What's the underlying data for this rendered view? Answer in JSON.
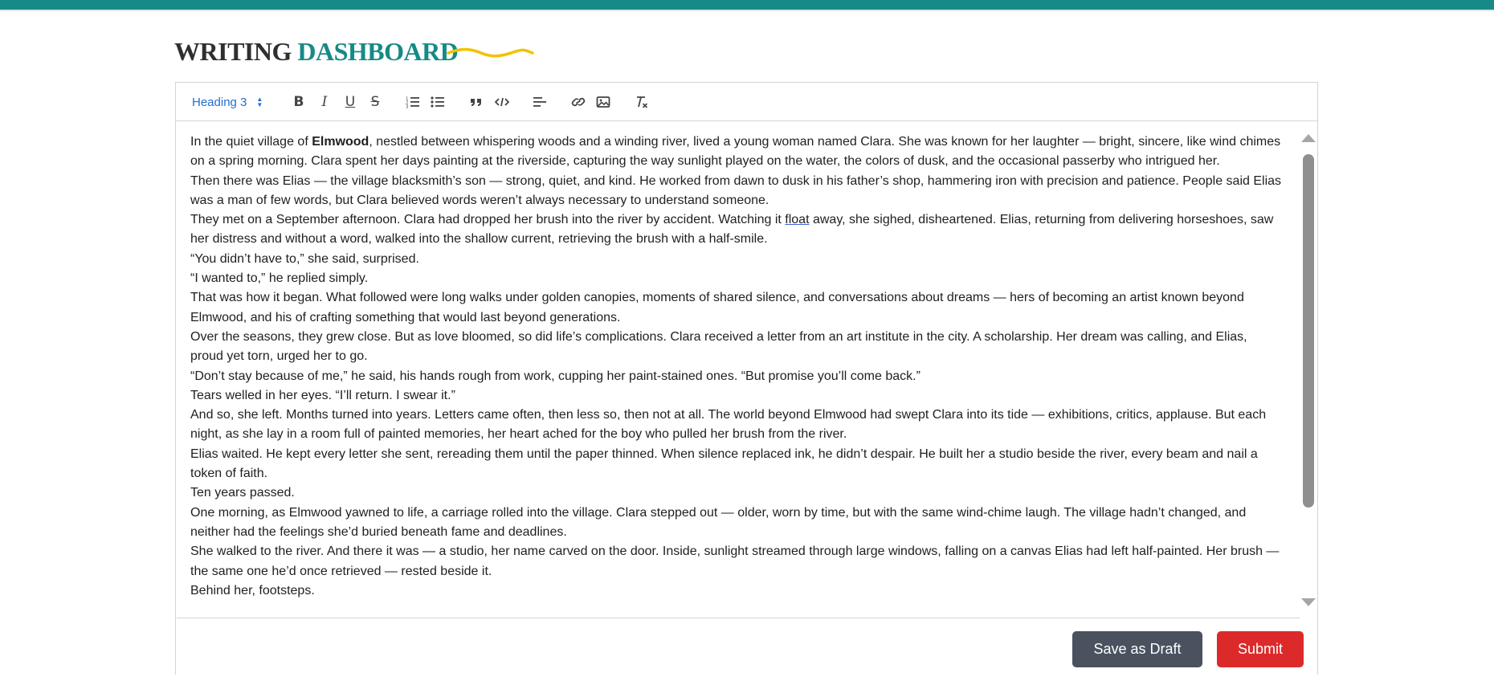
{
  "page": {
    "title_part1": "WRITING",
    "title_part2": "DASHBOARD"
  },
  "colors": {
    "accent": "#168a86",
    "highlight_squiggle": "#f2c200",
    "link_blue": "#1f6fd1",
    "draft_button": "#4a5260",
    "submit_button": "#dc2a2a"
  },
  "toolbar": {
    "heading_select": "Heading 3",
    "icons": [
      "bold-icon",
      "italic-icon",
      "underline-icon",
      "strikethrough-icon",
      "ordered-list-icon",
      "bullet-list-icon",
      "blockquote-icon",
      "code-icon",
      "align-icon",
      "link-icon",
      "image-icon",
      "clear-format-icon"
    ]
  },
  "editor": {
    "p1_before": "In the quiet village of ",
    "p1_bold": "Elmwood",
    "p1_after": ", nestled between whispering woods and a winding river, lived a young woman named Clara. She was known for her laughter — bright, sincere, like wind chimes on a spring morning. Clara spent her days painting at the riverside, capturing the way sunlight played on the water, the colors of dusk, and the occasional passerby who intrigued her.",
    "p2": "Then there was Elias — the village blacksmith’s son — strong, quiet, and kind. He worked from dawn to dusk in his father’s shop, hammering iron with precision and patience. People said Elias was a man of few words, but Clara believed words weren’t always necessary to understand someone.",
    "p3_before": "They met on a September afternoon. Clara had dropped her brush into the river by accident. Watching it ",
    "p3_underline": "float",
    "p3_after": " away, she sighed, disheartened. Elias, returning from delivering horseshoes, saw her distress and without a word, walked into the shallow current, retrieving the brush with a half-smile.",
    "p4": "“You didn’t have to,” she said, surprised.",
    "p5": "“I wanted to,” he replied simply.",
    "p6": "That was how it began. What followed were long walks under golden canopies, moments of shared silence, and conversations about dreams — hers of becoming an artist known beyond Elmwood, and his of crafting something that would last beyond generations.",
    "p7": "Over the seasons, they grew close. But as love bloomed, so did life’s complications. Clara received a letter from an art institute in the city. A scholarship. Her dream was calling, and Elias, proud yet torn, urged her to go.",
    "p8": "“Don’t stay because of me,” he said, his hands rough from work, cupping her paint-stained ones. “But promise you’ll come back.”",
    "p9": "Tears welled in her eyes. “I’ll return. I swear it.”",
    "p10": "And so, she left. Months turned into years. Letters came often, then less so, then not at all. The world beyond Elmwood had swept Clara into its tide — exhibitions, critics, applause. But each night, as she lay in a room full of painted memories, her heart ached for the boy who pulled her brush from the river.",
    "p11": "Elias waited. He kept every letter she sent, rereading them until the paper thinned. When silence replaced ink, he didn’t despair. He built her a studio beside the river, every beam and nail a token of faith.",
    "p12": "Ten years passed.",
    "p13": "One morning, as Elmwood yawned to life, a carriage rolled into the village. Clara stepped out — older, worn by time, but with the same wind-chime laugh. The village hadn’t changed, and neither had the feelings she’d buried beneath fame and deadlines.",
    "p14": "She walked to the river. And there it was — a studio, her name carved on the door. Inside, sunlight streamed through large windows, falling on a canvas Elias had left half-painted. Her brush — the same one he’d once retrieved — rested beside it.",
    "p15": "Behind her, footsteps."
  },
  "actions": {
    "draft_label": "Save as Draft",
    "submit_label": "Submit"
  }
}
